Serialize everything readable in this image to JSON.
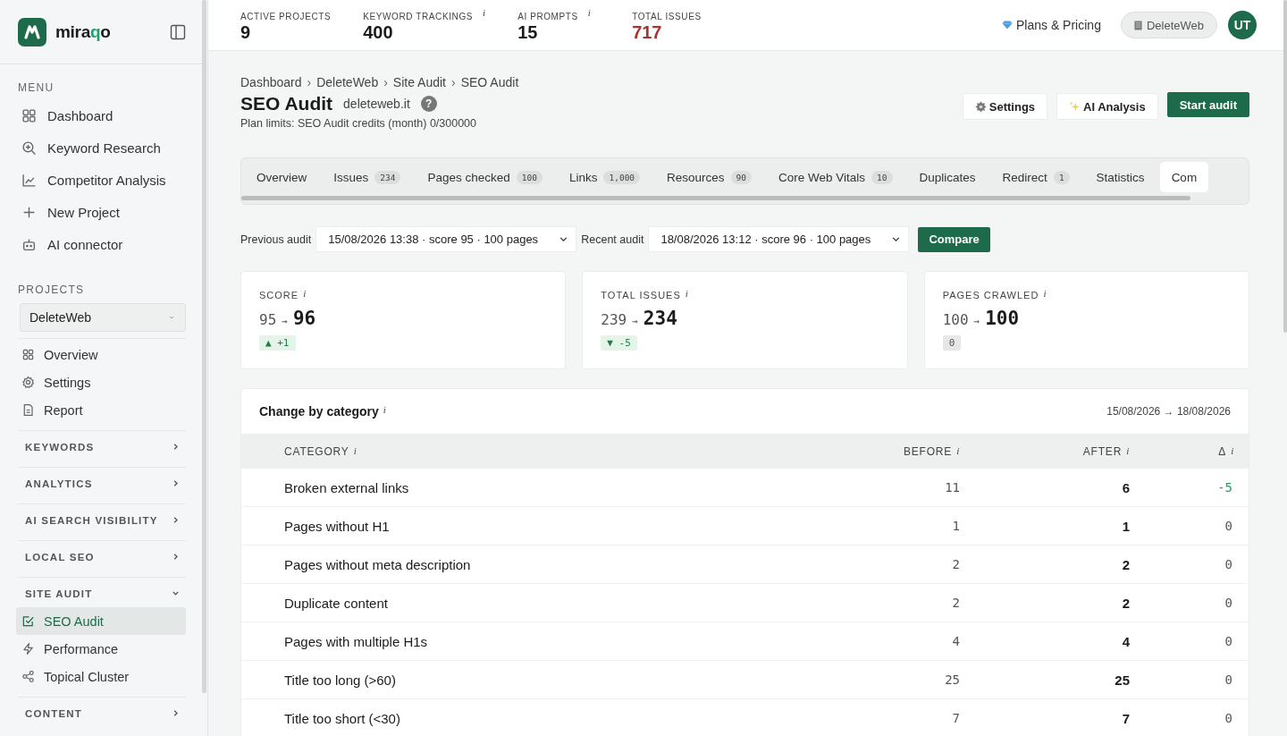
{
  "sidebar": {
    "brand_parts": [
      {
        "text": "mira",
        "accent": false
      },
      {
        "text": "q",
        "accent": true
      },
      {
        "text": "o",
        "accent": false
      }
    ],
    "menu_label": "MENU",
    "menu": [
      {
        "label": "Dashboard",
        "selected": false
      },
      {
        "label": "Keyword Research",
        "selected": false
      },
      {
        "label": "Competitor Analysis",
        "selected": false
      },
      {
        "label": "New Project",
        "selected": false
      },
      {
        "label": "AI connector",
        "selected": false
      }
    ],
    "projects_label": "PROJECTS",
    "project_select": {
      "value": "DeleteWeb"
    },
    "project_nav": [
      {
        "label": "Overview",
        "selected": false
      },
      {
        "label": "Settings",
        "selected": false
      },
      {
        "label": "Report",
        "selected": false
      }
    ],
    "groups": [
      {
        "label": "KEYWORDS",
        "expanded": false
      },
      {
        "label": "ANALYTICS",
        "expanded": false
      },
      {
        "label": "AI SEARCH VISIBILITY",
        "expanded": false
      },
      {
        "label": "LOCAL SEO",
        "expanded": false
      },
      {
        "label": "SITE AUDIT",
        "expanded": true,
        "children": [
          {
            "label": "SEO Audit",
            "selected": true
          },
          {
            "label": "Performance",
            "selected": false
          },
          {
            "label": "Topical Cluster",
            "selected": false
          }
        ]
      },
      {
        "label": "CONTENT",
        "expanded": false
      }
    ]
  },
  "topbar": {
    "stats": [
      {
        "label": "ACTIVE PROJECTS",
        "value": "9",
        "alert": false
      },
      {
        "label": "KEYWORD TRACKINGS",
        "info": "i",
        "value": "400",
        "alert": false
      },
      {
        "label": "AI PROMPTS",
        "info": "i",
        "value": "15",
        "alert": false
      },
      {
        "label": "TOTAL ISSUES",
        "value": "717",
        "alert": true
      }
    ],
    "plans_link": "Plans & Pricing",
    "workspace": "DeleteWeb",
    "avatar": "UT"
  },
  "breadcrumb": [
    "Dashboard",
    "DeleteWeb",
    "Site Audit",
    "SEO Audit"
  ],
  "breadcrumb_separator": "›",
  "page": {
    "title": "SEO Audit",
    "domain": "deleteweb.it",
    "help": "?",
    "plan_limits": "Plan limits: SEO Audit credits (month) 0/300000"
  },
  "actions": [
    {
      "label": "Settings",
      "kind": "settings"
    },
    {
      "label": "AI Analysis",
      "kind": "ai"
    },
    {
      "label": "Start audit",
      "kind": "primary"
    }
  ],
  "tabs": [
    {
      "label": "Overview",
      "selected": false
    },
    {
      "label": "Issues",
      "count": "234",
      "selected": false
    },
    {
      "label": "Pages checked",
      "count": "100",
      "selected": false
    },
    {
      "label": "Links",
      "count": "1,000",
      "selected": false
    },
    {
      "label": "Resources",
      "count": "90",
      "selected": false
    },
    {
      "label": "Core Web Vitals",
      "count": "10",
      "selected": false
    },
    {
      "label": "Duplicates",
      "selected": false
    },
    {
      "label": "Redirect",
      "count": "1",
      "selected": false
    },
    {
      "label": "Statistics",
      "selected": false
    },
    {
      "label": "Com",
      "selected": true
    }
  ],
  "compare": {
    "previous_label": "Previous audit",
    "previous_value": "15/08/2026 13:38 · score 95 · 100 pages",
    "recent_label": "Recent audit",
    "recent_value": "18/08/2026 13:12 · score 96 · 100 pages",
    "button": "Compare"
  },
  "summary_cards": [
    {
      "label": "SCORE",
      "info": "i",
      "from": "95",
      "arrow": "→",
      "to": "96",
      "delta": "▲ +1",
      "improved": true
    },
    {
      "label": "TOTAL ISSUES",
      "info": "i",
      "from": "239",
      "arrow": "→",
      "to": "234",
      "delta": "▼ -5",
      "improved": true
    },
    {
      "label": "PAGES CRAWLED",
      "info": "i",
      "from": "100",
      "arrow": "→",
      "to": "100",
      "delta": "0",
      "improved": false
    }
  ],
  "category_table": {
    "title": "Change by category",
    "info": "i",
    "date_range": "15/08/2026 → 18/08/2026",
    "columns": [
      {
        "label": "CATEGORY",
        "info": "i"
      },
      {
        "label": "BEFORE",
        "info": "i"
      },
      {
        "label": "AFTER",
        "info": "i"
      },
      {
        "label": "Δ",
        "info": "i"
      }
    ],
    "rows": [
      {
        "category": "Broken external links",
        "before": "11",
        "after": "6",
        "delta": "-5",
        "improved": true
      },
      {
        "category": "Pages without H1",
        "before": "1",
        "after": "1",
        "delta": "0",
        "improved": false
      },
      {
        "category": "Pages without meta description",
        "before": "2",
        "after": "2",
        "delta": "0",
        "improved": false
      },
      {
        "category": "Duplicate content",
        "before": "2",
        "after": "2",
        "delta": "0",
        "improved": false
      },
      {
        "category": "Pages with multiple H1s",
        "before": "4",
        "after": "4",
        "delta": "0",
        "improved": false
      },
      {
        "category": "Title too long (>60)",
        "before": "25",
        "after": "25",
        "delta": "0",
        "improved": false
      },
      {
        "category": "Title too short (<30)",
        "before": "7",
        "after": "7",
        "delta": "0",
        "improved": false
      }
    ]
  }
}
